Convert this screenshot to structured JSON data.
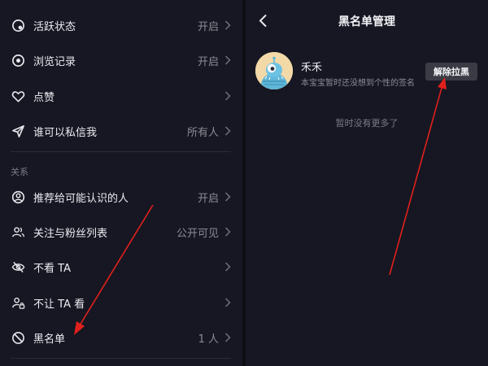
{
  "left_panel": {
    "items": [
      {
        "label": "活跃状态",
        "value": "开启",
        "icon": "activity-status-icon"
      },
      {
        "label": "浏览记录",
        "value": "开启",
        "icon": "eye-icon"
      },
      {
        "label": "点赞",
        "value": "",
        "icon": "heart-icon"
      },
      {
        "label": "谁可以私信我",
        "value": "所有人",
        "icon": "send-icon"
      }
    ],
    "section_label": "关系",
    "relation_items": [
      {
        "label": "推荐给可能认识的人",
        "value": "开启",
        "icon": "user-circle-icon"
      },
      {
        "label": "关注与粉丝列表",
        "value": "公开可见",
        "icon": "users-icon"
      },
      {
        "label": "不看 TA",
        "value": "",
        "icon": "eye-off-icon"
      },
      {
        "label": "不让 TA 看",
        "value": "",
        "icon": "user-lock-icon"
      },
      {
        "label": "黑名单",
        "value": "1 人",
        "icon": "block-icon"
      }
    ]
  },
  "right_panel": {
    "title": "黑名单管理",
    "user": {
      "name": "禾禾",
      "signature": "本宝宝暂时还没想到个性的签名"
    },
    "unblock_label": "解除拉黑",
    "empty_text": "暂时没有更多了"
  },
  "colors": {
    "background": "#161722",
    "annotation_arrow": "#e0201c"
  }
}
